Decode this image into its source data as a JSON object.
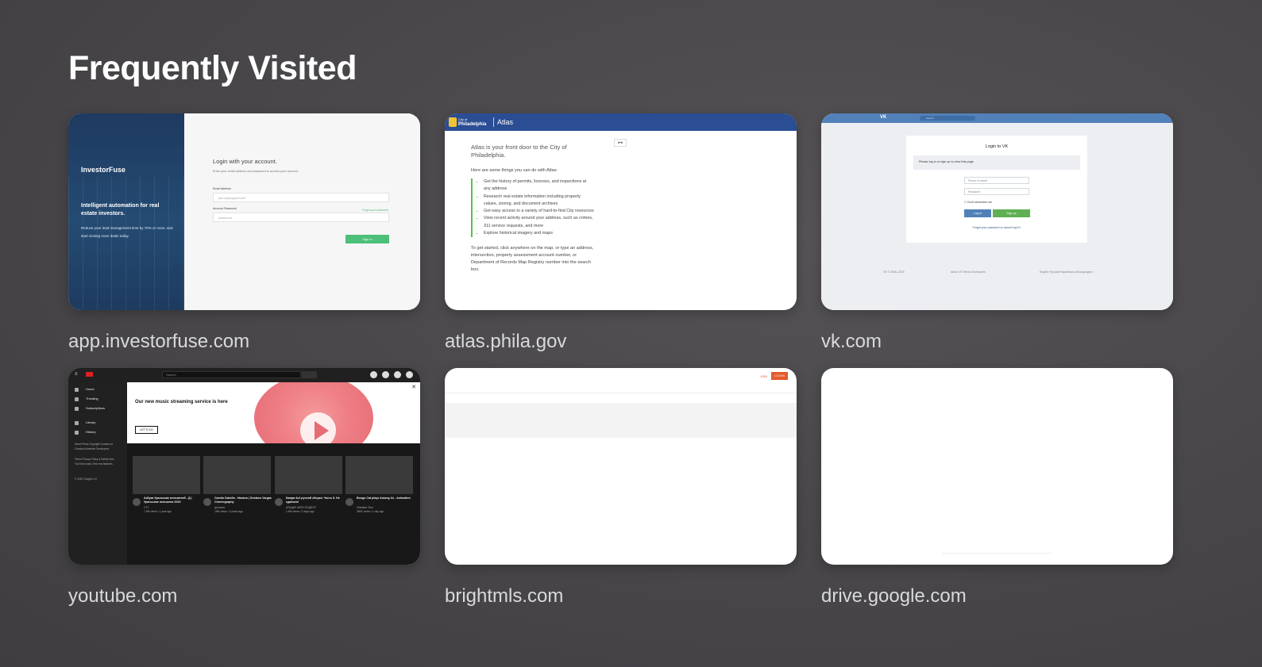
{
  "section_title": "Frequently Visited",
  "tiles": [
    {
      "label": "app.investorfuse.com"
    },
    {
      "label": "atlas.phila.gov"
    },
    {
      "label": "vk.com"
    },
    {
      "label": "youtube.com"
    },
    {
      "label": "brightmls.com"
    },
    {
      "label": "drive.google.com"
    }
  ],
  "investorfuse": {
    "logo": "InvestorFuse",
    "tagline": "Intelligent automation for real estate investors.",
    "subtext": "Reduce your lead management time by 70% or more, and start closing more deals today.",
    "heading": "Login with your account.",
    "instructions": "Enter your email address and password to access your account.",
    "email_label": "Email Address",
    "email_placeholder": "johnny@appleseed",
    "password_label": "Account Password",
    "password_placeholder": "password",
    "forgot": "Forgot your password",
    "signin": "Sign In"
  },
  "atlas": {
    "city_small": "City of",
    "city": "Philadelphia",
    "app": "Atlas",
    "lead": "Atlas is your front door to the City of Philadelphia.",
    "intro": "Here are some things you can do with Atlas:",
    "items": [
      "Get the history of permits, licenses, and inspections at any address",
      "Research real estate information including property values, zoning, and document archives",
      "Get easy access to a variety of hard-to-find City resources",
      "View recent activity around your address, such as crimes, 311 service requests, and more",
      "Explore historical imagery and maps"
    ],
    "outro": "To get started, click anywhere on the map, or type an address, intersection, property assessment account number, or Department of Records Map Registry number into the search box."
  },
  "vk": {
    "search": "Search",
    "title": "Login to VK",
    "note": "Please log in or sign up to view this page",
    "phone_placeholder": "Phone or email",
    "password_placeholder": "Password",
    "remember": "Don't remember me",
    "login": "Log in",
    "signup": "Sign up",
    "forgot": "Forgot your password or cannot log in?",
    "copyright": "VK © 2006–2020",
    "links": "About VK   Terms   Developers",
    "languages": "English   Русский   Українська   all languages »"
  },
  "youtube": {
    "search": "Search",
    "nav": [
      "Home",
      "Trending",
      "Subscriptions",
      "Library",
      "History"
    ],
    "footer1": "About  Press  Copyright  Contact us  Creators  Advertise  Developers",
    "footer2": "Terms  Privacy  Policy & Safety  How YouTube works  Test new features",
    "footer3": "© 2020 Google LLC",
    "banner_text": "Our new music streaming service is here",
    "banner_button": "LET'S GO",
    "videos": [
      {
        "title": "Азбука Уральских пельменей - Д | Уральские пельмени 2019",
        "channel": "СТС",
        "meta": "7.5M views • 1 year ago"
      },
      {
        "title": "Camila Cabello - Havana | Gustavo Vargas Choreography",
        "channel": "gvvsarex",
        "meta": "15M views • 3 years ago"
      },
      {
        "title": "Камри 4x4 ручной сборки. Часть 8. Не сдаёмся!",
        "channel": "ИЛЬДАР АВТО-ПОДБОР",
        "meta": "1.6M views • 2 days ago"
      },
      {
        "title": "Bongo Cat plays Among Us - Animation",
        "channel": "Obsidian Time",
        "meta": "360K views • 1 day ago"
      }
    ]
  },
  "brightmls": {
    "join": "JOIN",
    "login": "LOGIN"
  }
}
